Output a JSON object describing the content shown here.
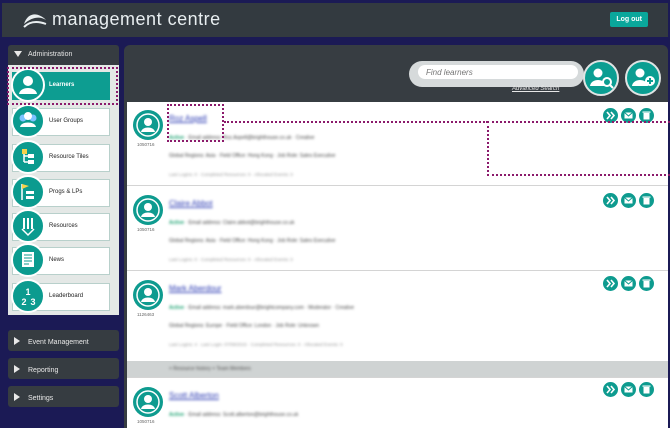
{
  "header": {
    "app_title": "management centre",
    "logout_label": "Log out"
  },
  "sidebar": {
    "section_title": "Administration",
    "items": [
      {
        "label": "Learners",
        "icon": "user-icon",
        "active": true
      },
      {
        "label": "User Groups",
        "icon": "users-icon",
        "active": false
      },
      {
        "label": "Resource Tiles",
        "icon": "tiles-icon",
        "active": false
      },
      {
        "label": "Progs & LPs",
        "icon": "flags-icon",
        "active": false
      },
      {
        "label": "Resources",
        "icon": "resources-icon",
        "active": false
      },
      {
        "label": "News",
        "icon": "news-icon",
        "active": false
      },
      {
        "label": "Leaderboard",
        "icon": "leaderboard-icon",
        "active": false
      }
    ],
    "leaderboard_icon_text": [
      "1",
      "2",
      "3"
    ],
    "sections": [
      "Event Management",
      "Reporting",
      "Settings"
    ]
  },
  "search": {
    "placeholder": "Find learners",
    "advanced_label": "Advanced Search"
  },
  "learners": [
    {
      "id": "1050716",
      "name": "Roz Aspell",
      "status": "Active",
      "line1": "Email address: Roz.Aspell@brighthouse.co.uk · Creative",
      "line2": "Global Regions: Asia · Field Office: Hong Kong · Job Role: Sales Executive",
      "line3": "Last Logins: 0 · Completed Resources: 0 · Allocated Events: 0"
    },
    {
      "id": "1050716",
      "name": "Claire Abbot",
      "status": "Active",
      "line1": "Email address: Claire.abbot@brighthouse.co.uk",
      "line2": "Global Regions: Asia · Field Office: Hong Kong · Job Role: Sales Executive",
      "line3": "Last Logins: 0 · Completed Resources: 0 · Allocated Events: 0"
    },
    {
      "id": "1126463",
      "name": "Mark Aberdour",
      "status": "Active",
      "line1": "Email address: mark.aberdour@brightcompany.com · Moderator · Creative",
      "line2": "Global Regions: Europe · Field Office: London · Job Role: Unknown",
      "line3": "Last Logins: 4 · Last Login: 07/09/2015 · Completed Resources: 0 · Allocated Events: 0",
      "footer": "+ Resource history   + Team Members"
    },
    {
      "id": "1050716",
      "name": "Scott Alberton",
      "status": "Active",
      "line1": "Email address: Scott.alberton@brighthouse.co.uk"
    }
  ]
}
